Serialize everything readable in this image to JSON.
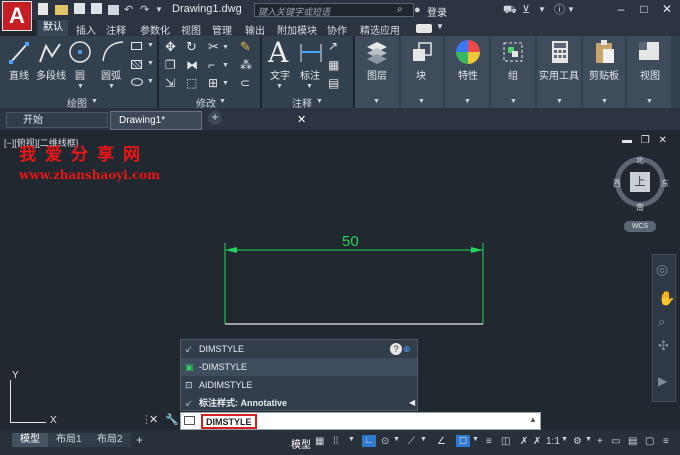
{
  "app": {
    "logo_letter": "A",
    "title": "Drawing1.dwg"
  },
  "search": {
    "placeholder": "键入关键字或短语"
  },
  "user": {
    "login_label": "登录"
  },
  "menu_tabs": [
    "默认",
    "插入",
    "注释",
    "参数化",
    "视图",
    "管理",
    "输出",
    "附加模块",
    "协作",
    "精选应用"
  ],
  "ribbon": {
    "draw_tools": [
      "直线",
      "多段线",
      "圆",
      "圆弧"
    ],
    "draw_group": "绘图",
    "modify_group": "修改",
    "annot_tools": [
      "文字",
      "标注"
    ],
    "annot_group": "注释",
    "panels": [
      "图层",
      "块",
      "特性",
      "组",
      "实用工具",
      "剪贴板",
      "视图"
    ]
  },
  "doc_tabs": {
    "start": "开始",
    "drawing": "Drawing1*"
  },
  "viewport": {
    "label": "[−][俯视][二维线框]",
    "cube_face": "上",
    "n": "北",
    "s": "南",
    "w": "西",
    "e": "东",
    "wcs": "WCS"
  },
  "watermark": {
    "cn": "我爱分享网",
    "url": "www.zhanshaoyi.com"
  },
  "dimension": {
    "value": "50"
  },
  "axes": {
    "x": "X",
    "y": "Y"
  },
  "autocomplete": {
    "items": [
      "DIMSTYLE",
      "-DIMSTYLE",
      "AIDIMSTYLE"
    ],
    "style_row": "标注样式: Annotative"
  },
  "command": {
    "value": "DIMSTYLE"
  },
  "layouts": [
    "模型",
    "布局1",
    "布局2"
  ],
  "status": {
    "model": "模型",
    "scale": "1:1"
  }
}
